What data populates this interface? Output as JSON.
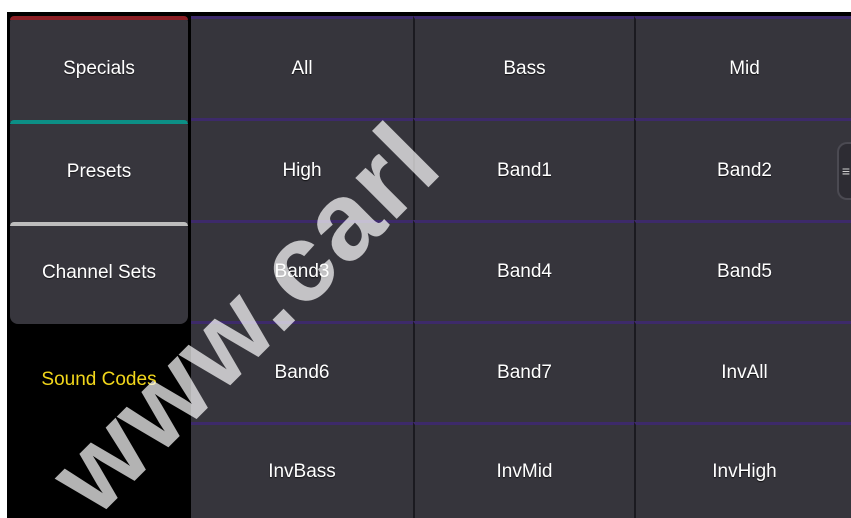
{
  "sidebar": {
    "tabs": [
      {
        "label": "Specials",
        "accent": "#8b1f25"
      },
      {
        "label": "Presets",
        "accent": "#0c8f86"
      },
      {
        "label": "Channel Sets",
        "accent": "#bdbdbd"
      }
    ],
    "active_tab": {
      "label": "Sound Codes",
      "color": "#f1d61b"
    }
  },
  "grid": {
    "buttons": [
      "All",
      "Bass",
      "Mid",
      "High",
      "Band1",
      "Band2",
      "Band3",
      "Band4",
      "Band5",
      "Band6",
      "Band7",
      "InvAll",
      "InvBass",
      "InvMid",
      "InvHigh"
    ],
    "cell_accent": "#3d2a6a"
  },
  "handle": {
    "glyph": "≡"
  },
  "watermark": {
    "text": "www.carl"
  }
}
